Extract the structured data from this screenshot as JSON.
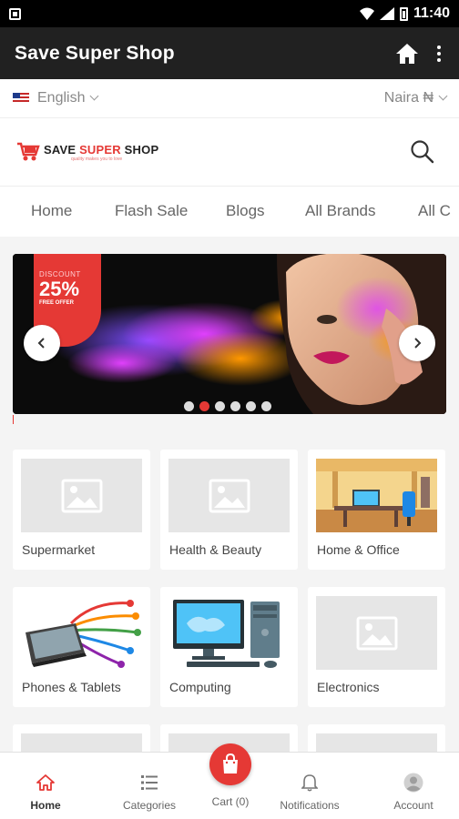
{
  "status_bar": {
    "time": "11:40"
  },
  "app_bar": {
    "title": "Save Super Shop"
  },
  "lang_bar": {
    "language": "English",
    "currency": "Naira ₦"
  },
  "logo": {
    "brand_part1": "SAVE ",
    "brand_part2": "SUPER",
    "brand_part3": " SHOP",
    "tagline": "quality makes you to love"
  },
  "nav_tabs": [
    "Home",
    "Flash Sale",
    "Blogs",
    "All Brands",
    "All C"
  ],
  "banner": {
    "discount_label": "DISCOUNT",
    "discount_value": "25%",
    "discount_sub": "FREE OFFER",
    "active_dot": 1,
    "dot_count": 6
  },
  "categories": [
    {
      "label": "Supermarket",
      "image": "placeholder"
    },
    {
      "label": "Health & Beauty",
      "image": "placeholder"
    },
    {
      "label": "Home & Office",
      "image": "office"
    },
    {
      "label": "Phones & Tablets",
      "image": "tablet"
    },
    {
      "label": "Computing",
      "image": "computer"
    },
    {
      "label": "Electronics",
      "image": "placeholder"
    }
  ],
  "bottom_nav": {
    "home": "Home",
    "categories": "Categories",
    "cart": "Cart (0)",
    "notifications": "Notifications",
    "account": "Account"
  },
  "colors": {
    "accent": "#e53935",
    "app_bar": "#212121"
  }
}
